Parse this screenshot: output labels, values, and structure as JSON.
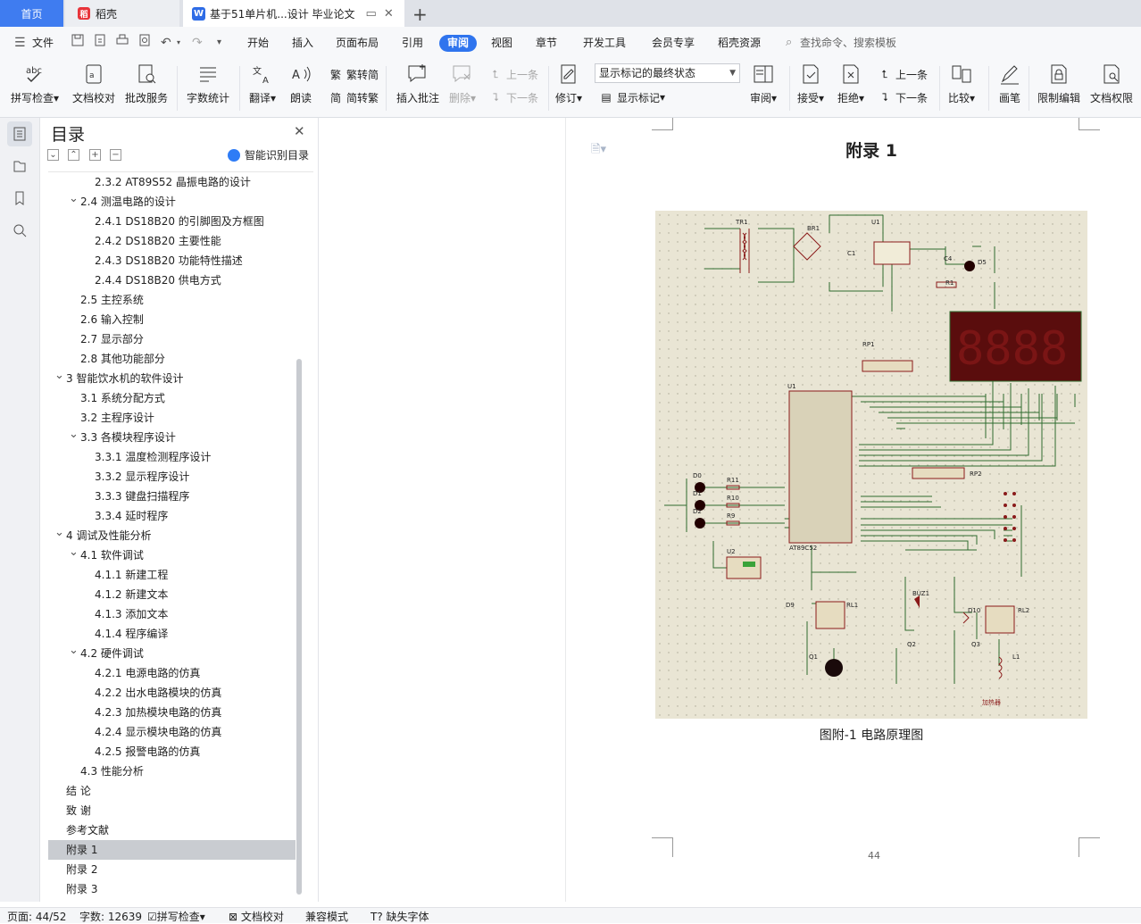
{
  "tabs": {
    "home": "首页",
    "daoke": "稻壳",
    "doc": "基于51单片机...设计 毕业论文"
  },
  "menu": {
    "file": "文件",
    "items": [
      "开始",
      "插入",
      "页面布局",
      "引用",
      "审阅",
      "视图",
      "章节",
      "开发工具",
      "会员专享",
      "稻壳资源"
    ],
    "active_index": 4,
    "search_placeholder": "查找命令、搜索模板"
  },
  "ribbon": {
    "spell_check": "拼写检查",
    "doc_proof": "文档校对",
    "batch_service": "批改服务",
    "word_count": "字数统计",
    "translate": "翻译",
    "read_aloud": "朗读",
    "trad_simp": "繁转简",
    "simp_trad": "简转繁",
    "insert_comment": "插入批注",
    "delete": "删除",
    "prev_comment": "上一条",
    "next_comment": "下一条",
    "revise": "修订",
    "markup_select": "显示标记的最终状态",
    "show_markup": "显示标记",
    "review": "审阅",
    "accept": "接受",
    "reject": "拒绝",
    "prev_change": "上一条",
    "next_change": "下一条",
    "compare": "比较",
    "pen": "画笔",
    "restrict_edit": "限制编辑",
    "doc_permission": "文档权限"
  },
  "toc": {
    "title": "目录",
    "smart": "智能识别目录",
    "items": [
      {
        "text": "2.3.2 AT89S52 晶振电路的设计",
        "level": 3
      },
      {
        "text": "2.4  测温电路的设计",
        "level": 2,
        "caret": true
      },
      {
        "text": "2.4.1 DS18B20 的引脚图及方框图",
        "level": 3
      },
      {
        "text": "2.4.2 DS18B20 主要性能",
        "level": 3
      },
      {
        "text": "2.4.3 DS18B20 功能特性描述",
        "level": 3
      },
      {
        "text": "2.4.4 DS18B20 供电方式",
        "level": 3
      },
      {
        "text": "2.5  主控系统",
        "level": 2
      },
      {
        "text": "2.6  输入控制",
        "level": 2
      },
      {
        "text": "2.7  显示部分",
        "level": 2
      },
      {
        "text": "2.8  其他功能部分",
        "level": 2
      },
      {
        "text": "3  智能饮水机的软件设计",
        "level": 1,
        "caret": true
      },
      {
        "text": "3.1  系统分配方式",
        "level": 2
      },
      {
        "text": "3.2  主程序设计",
        "level": 2
      },
      {
        "text": "3.3  各模块程序设计",
        "level": 2,
        "caret": true
      },
      {
        "text": "3.3.1  温度检测程序设计",
        "level": 3
      },
      {
        "text": "3.3.2  显示程序设计",
        "level": 3
      },
      {
        "text": "3.3.3  键盘扫描程序",
        "level": 3
      },
      {
        "text": "3.3.4  延时程序",
        "level": 3
      },
      {
        "text": "4  调试及性能分析",
        "level": 1,
        "caret": true
      },
      {
        "text": "4.1  软件调试",
        "level": 2,
        "caret": true
      },
      {
        "text": "4.1.1  新建工程",
        "level": 3
      },
      {
        "text": "4.1.2  新建文本",
        "level": 3
      },
      {
        "text": "4.1.3  添加文本",
        "level": 3
      },
      {
        "text": "4.1.4  程序编译",
        "level": 3
      },
      {
        "text": "4.2  硬件调试",
        "level": 2,
        "caret": true
      },
      {
        "text": "4.2.1  电源电路的仿真",
        "level": 3
      },
      {
        "text": "4.2.2  出水电路模块的仿真",
        "level": 3
      },
      {
        "text": "4.2.3  加热模块电路的仿真",
        "level": 3
      },
      {
        "text": "4.2.4  显示模块电路的仿真",
        "level": 3
      },
      {
        "text": "4.2.5  报警电路的仿真",
        "level": 3
      },
      {
        "text": "4.3  性能分析",
        "level": 2
      },
      {
        "text": "结   论",
        "level": 0
      },
      {
        "text": "致  谢",
        "level": 0
      },
      {
        "text": "参考文献",
        "level": 0
      },
      {
        "text": "附录 1",
        "level": 0,
        "selected": true
      },
      {
        "text": "附录 2",
        "level": 0
      },
      {
        "text": "附录 3",
        "level": 0
      }
    ]
  },
  "document": {
    "heading": "附录 1",
    "caption": "图附-1   电路原理图",
    "page_number": "44",
    "circuit_labels": {
      "tr1": "TR1",
      "br1": "BR1",
      "u1_reg": "U1",
      "c1": "C1",
      "c4": "C4",
      "d5": "D5",
      "r1": "R1",
      "rp1": "RP1",
      "u1": "U1",
      "rp2": "RP2",
      "d0": "D0",
      "d1": "D1",
      "d2": "D2",
      "r11": "R11",
      "r10": "R10",
      "r9": "R9",
      "u2": "U2",
      "d9": "D9",
      "rl1": "RL1",
      "q1": "Q1",
      "buz1": "BUZ1",
      "q2": "Q2",
      "d10": "D10",
      "rl2": "RL2",
      "q3": "Q3",
      "l1": "L1",
      "display_digits": "8888",
      "mcu": "AT89C52",
      "heater": "加热器"
    }
  },
  "status": {
    "page": "页面: 44/52",
    "words": "字数: 12639",
    "spell": "拼写检查",
    "proof": "文档校对",
    "compat": "兼容模式",
    "missing_font": "缺失字体"
  },
  "colors": {
    "accent": "#2f74ee",
    "home_tab": "#3f7cf0",
    "circuit_bg": "#e9e5d4",
    "wire": "#2e6b2e",
    "component": "#8a1a1a"
  }
}
